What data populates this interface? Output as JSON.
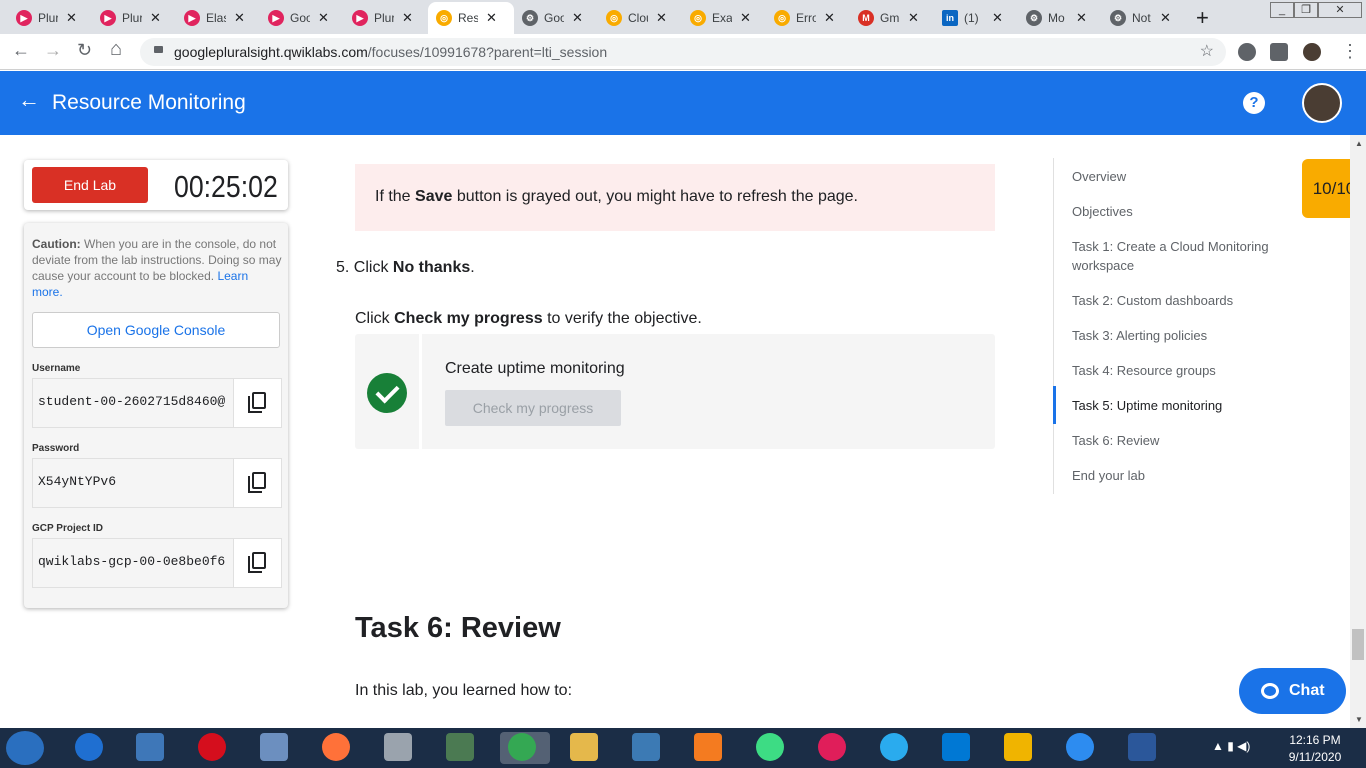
{
  "browser": {
    "tabs": [
      {
        "label": "Plur",
        "color": "#e0245e"
      },
      {
        "label": "Plur",
        "color": "#e0245e"
      },
      {
        "label": "Elas",
        "color": "#e0245e"
      },
      {
        "label": "Goo",
        "color": "#e0245e"
      },
      {
        "label": "Plur",
        "color": "#e0245e"
      },
      {
        "label": "Res",
        "color": "#f9ab00"
      },
      {
        "label": "Goo",
        "color": "#5f6368"
      },
      {
        "label": "Clou",
        "color": "#f9ab00"
      },
      {
        "label": "Exa",
        "color": "#f9ab00"
      },
      {
        "label": "Erro",
        "color": "#f9ab00"
      },
      {
        "label": "Gm",
        "color": "#d93025"
      },
      {
        "label": "(1)",
        "color": "#0a66c2"
      },
      {
        "label": "Mo",
        "color": "#5f6368"
      },
      {
        "label": "Not",
        "color": "#5f6368"
      }
    ],
    "close_glyph": "✕",
    "new_tab": "+",
    "url_domain": "googlepluralsight.qwiklabs.com",
    "url_path": "/focuses/10991678?parent=lti_session",
    "star": "☆",
    "back": "←",
    "forward": "→",
    "reload": "↻",
    "home": "⌂",
    "menu": "⋮"
  },
  "header": {
    "back_arrow": "←",
    "title": "Resource Monitoring",
    "help": "?"
  },
  "lab": {
    "end_lab": "End Lab",
    "timer": "00:25:02",
    "caution_bold": "Caution:",
    "caution_text": " When you are in the console, do not deviate from the lab instructions. Doing so may cause your account to be blocked. ",
    "learn_more": "Learn more.",
    "open_console": "Open Google Console",
    "username_label": "Username",
    "username": "student-00-2602715d8460@",
    "password_label": "Password",
    "password": "X54yNtYPv6",
    "project_label": "GCP Project ID",
    "project": "qwiklabs-gcp-00-0e8be0f6"
  },
  "content": {
    "note_pre": "If the ",
    "note_bold": "Save",
    "note_post": " button is grayed out, you might have to refresh the page.",
    "step5_pre": "5. Click ",
    "step5_bold": "No thanks",
    "step5_post": ".",
    "check_pre": "Click ",
    "check_bold": "Check my progress",
    "check_post": " to verify the objective.",
    "check_title": "Create uptime monitoring",
    "check_button": "Check my progress",
    "task6_title": "Task 6: Review",
    "learn_text": "In this lab, you learned how to:"
  },
  "toc": [
    "Overview",
    "Objectives",
    "Task 1: Create a Cloud Monitoring workspace",
    "Task 2: Custom dashboards",
    "Task 3: Alerting policies",
    "Task 4: Resource groups",
    "Task 5: Uptime monitoring",
    "Task 6: Review",
    "End your lab"
  ],
  "score": "10/10",
  "chat": "Chat",
  "taskbar": {
    "time": "12:16 PM",
    "date": "9/11/2020",
    "tray": "▲  ▮  ◀)"
  }
}
